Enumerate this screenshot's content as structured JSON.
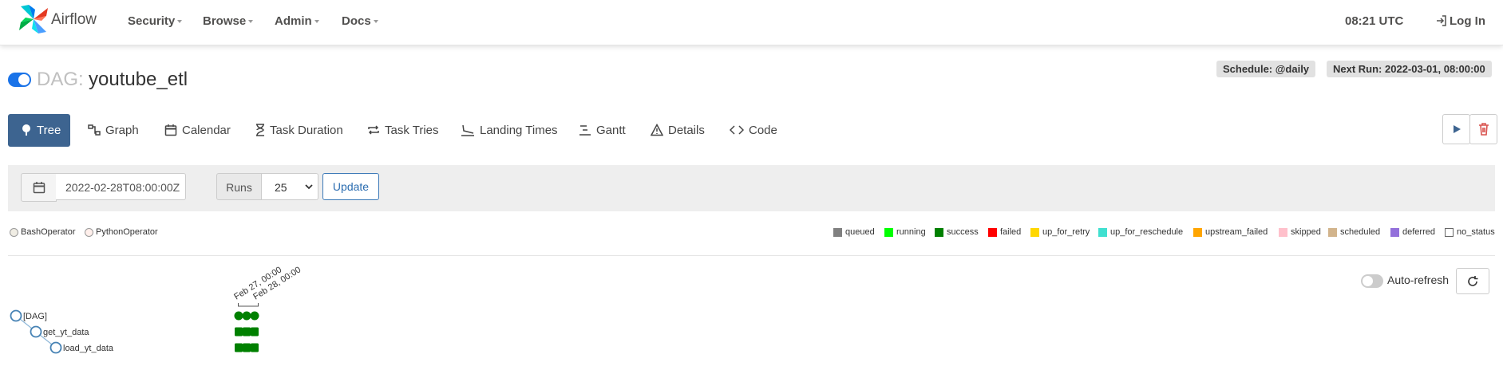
{
  "navbar": {
    "brand": "Airflow",
    "menus": [
      "Security",
      "Browse",
      "Admin",
      "Docs"
    ],
    "clock": "08:21 UTC",
    "login": "Log In"
  },
  "dag": {
    "prefix": "DAG:",
    "id": "youtube_etl",
    "paused": false,
    "schedule": "Schedule: @daily",
    "next_run": "Next Run: 2022-03-01, 08:00:00"
  },
  "tabs": [
    {
      "label": "Tree",
      "icon": "tree-icon",
      "active": true
    },
    {
      "label": "Graph",
      "icon": "graph-icon"
    },
    {
      "label": "Calendar",
      "icon": "calendar-icon"
    },
    {
      "label": "Task Duration",
      "icon": "hourglass-icon"
    },
    {
      "label": "Task Tries",
      "icon": "repeat-icon"
    },
    {
      "label": "Landing Times",
      "icon": "landing-icon"
    },
    {
      "label": "Gantt",
      "icon": "gantt-icon"
    },
    {
      "label": "Details",
      "icon": "warning-triangle-icon"
    },
    {
      "label": "Code",
      "icon": "code-icon"
    }
  ],
  "actions": {
    "trigger": "play-icon",
    "delete": "trash-icon"
  },
  "filter": {
    "base_date": "2022-02-28T08:00:00Z",
    "runs_label": "Runs",
    "runs_value": "25",
    "update": "Update"
  },
  "operators": [
    {
      "name": "BashOperator",
      "color": "#f0ede4"
    },
    {
      "name": "PythonOperator",
      "color": "#ffefeb"
    }
  ],
  "states": [
    {
      "name": "queued",
      "color": "#808080"
    },
    {
      "name": "running",
      "color": "#00ff00"
    },
    {
      "name": "success",
      "color": "#008000"
    },
    {
      "name": "failed",
      "color": "#ff0000"
    },
    {
      "name": "up_for_retry",
      "color": "#ffd700"
    },
    {
      "name": "up_for_reschedule",
      "color": "#40e0d0"
    },
    {
      "name": "upstream_failed",
      "color": "#ffa500"
    },
    {
      "name": "skipped",
      "color": "#ffc0cb"
    },
    {
      "name": "scheduled",
      "color": "#d2b48c"
    },
    {
      "name": "deferred",
      "color": "#9370db"
    },
    {
      "name": "no_status",
      "color": "#ffffff"
    }
  ],
  "auto_refresh": {
    "label": "Auto-refresh",
    "enabled": false
  },
  "tree": {
    "run_dates": [
      "Feb 27, 00:00",
      "Feb 28, 00:00"
    ],
    "nodes": [
      {
        "label": "[DAG]",
        "depth": 0,
        "states": [
          "success",
          "success",
          "success"
        ]
      },
      {
        "label": "get_yt_data",
        "depth": 1,
        "states": [
          "success",
          "success",
          "success"
        ]
      },
      {
        "label": "load_yt_data",
        "depth": 2,
        "states": [
          "success",
          "success",
          "success"
        ]
      }
    ]
  }
}
